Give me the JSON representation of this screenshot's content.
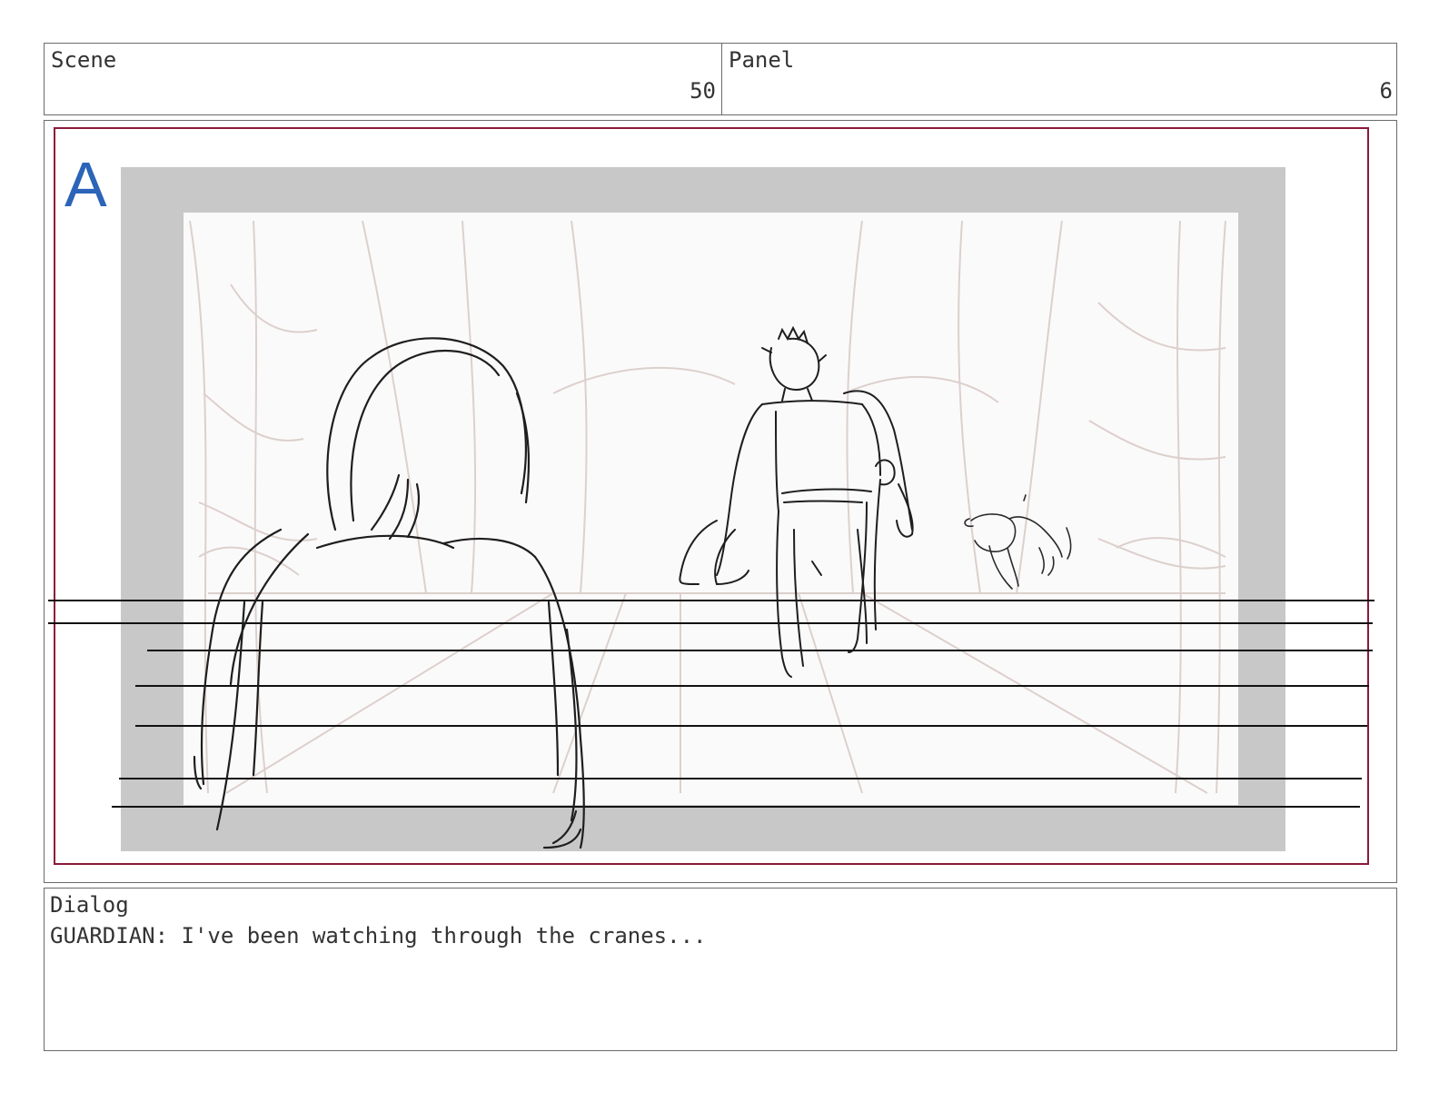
{
  "header": {
    "scene_label": "Scene",
    "scene_number": "50",
    "panel_label": "Panel",
    "panel_number": "6"
  },
  "frame": {
    "camera_marker": "A",
    "marker_color": "#2b64b8",
    "safe_area_color": "#8b1a3a"
  },
  "dialog": {
    "label": "Dialog",
    "text": "GUARDIAN: I've been watching through the cranes..."
  }
}
